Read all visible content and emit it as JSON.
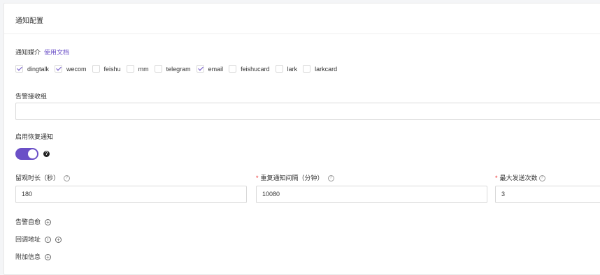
{
  "header": {
    "title": "通知配置"
  },
  "media": {
    "label": "通知媒介",
    "doc_link": "使用文档",
    "options": [
      {
        "label": "dingtalk",
        "checked": true
      },
      {
        "label": "wecom",
        "checked": true
      },
      {
        "label": "feishu",
        "checked": false
      },
      {
        "label": "mm",
        "checked": false
      },
      {
        "label": "telegram",
        "checked": false
      },
      {
        "label": "email",
        "checked": true
      },
      {
        "label": "feishucard",
        "checked": false
      },
      {
        "label": "lark",
        "checked": false
      },
      {
        "label": "larkcard",
        "checked": false
      }
    ]
  },
  "receiver": {
    "label": "告警接收组",
    "value": ""
  },
  "recovery": {
    "label": "启用恢复通知",
    "enabled": true,
    "help_icon": "question-circle-icon"
  },
  "observe": {
    "label": "留观时长（秒）",
    "value": "180"
  },
  "repeat": {
    "required_mark": "*",
    "label": "重复通知间隔（分钟）",
    "value": "10080"
  },
  "max_send": {
    "required_mark": "*",
    "label": "最大发送次数",
    "value": "3"
  },
  "self_heal": {
    "label": "告警自愈"
  },
  "callback": {
    "label": "回调地址"
  },
  "extra": {
    "label": "附加信息"
  },
  "colors": {
    "accent": "#6b50c7",
    "required": "#e33333"
  }
}
